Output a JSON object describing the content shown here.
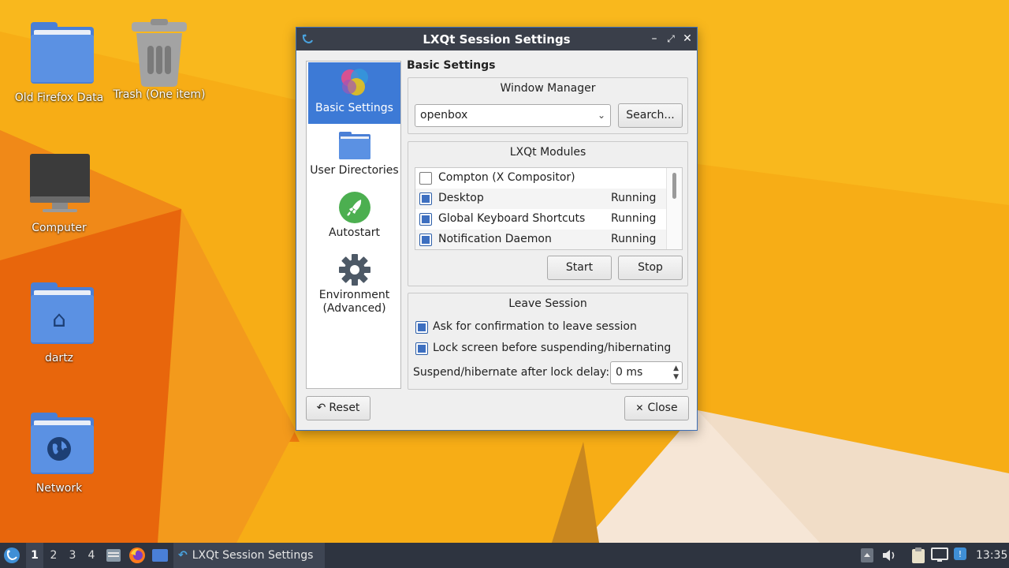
{
  "desktop": {
    "icons": [
      {
        "label": "Old Firefox Data"
      },
      {
        "label": "Trash (One item)"
      },
      {
        "label": "Computer"
      },
      {
        "label": "dartz"
      },
      {
        "label": "Network"
      }
    ]
  },
  "window": {
    "title": "LXQt Session Settings",
    "controls": {
      "minimize": "–",
      "maximize": "⤢",
      "close": "✕"
    },
    "sidebar": {
      "items": [
        {
          "label": "Basic Settings",
          "icon": "lxqt-logo-icon",
          "active": true
        },
        {
          "label": "User Directories",
          "icon": "folder-icon"
        },
        {
          "label": "Autostart",
          "icon": "rocket-icon"
        },
        {
          "label": "Environment (Advanced)",
          "icon": "gear-icon"
        }
      ]
    },
    "section_title": "Basic Settings",
    "window_manager": {
      "title": "Window Manager",
      "value": "openbox",
      "search_label": "Search..."
    },
    "modules": {
      "title": "LXQt Modules",
      "rows": [
        {
          "name": "Compton (X Compositor)",
          "checked": false,
          "state": ""
        },
        {
          "name": "Desktop",
          "checked": true,
          "state": "Running"
        },
        {
          "name": "Global Keyboard Shortcuts",
          "checked": true,
          "state": "Running"
        },
        {
          "name": "Notification Daemon",
          "checked": true,
          "state": "Running"
        }
      ],
      "start_label": "Start",
      "stop_label": "Stop"
    },
    "leave_session": {
      "title": "Leave Session",
      "confirm_label": "Ask for confirmation to leave session",
      "confirm_checked": true,
      "lock_label": "Lock screen before suspending/hibernating",
      "lock_checked": true,
      "delay_label": "Suspend/hibernate after lock delay:",
      "delay_value": "0 ms"
    },
    "reset_label": "Reset",
    "close_label": "Close"
  },
  "taskbar": {
    "workspaces": [
      "1",
      "2",
      "3",
      "4"
    ],
    "active_workspace": "1",
    "task_label": "LXQt Session Settings",
    "clock": "13:35"
  },
  "colors": {
    "accent": "#3d7ad6",
    "titlebar": "#3a3f4a",
    "taskbar": "#2e3440",
    "wallpaper": "#f6a814"
  }
}
